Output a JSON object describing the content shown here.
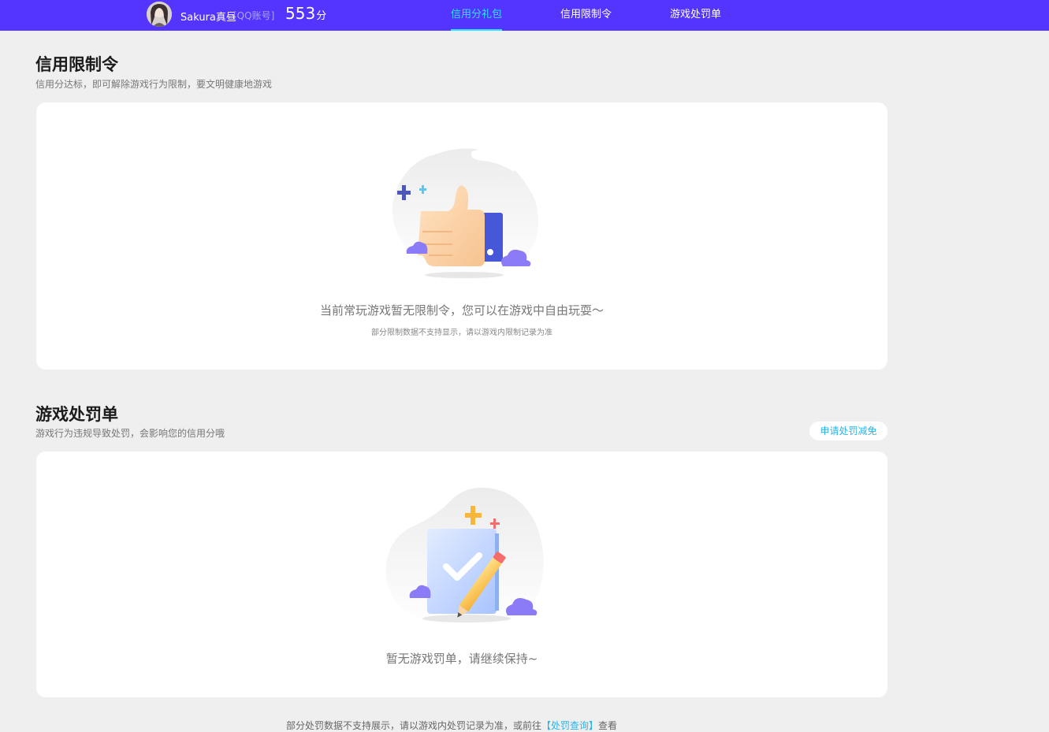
{
  "header": {
    "username": "Sakura真昼",
    "account_type": "[QQ账号]",
    "score": "553",
    "score_unit": "分",
    "tabs": [
      {
        "label": "信用分礼包",
        "active": true
      },
      {
        "label": "信用限制令",
        "active": false
      },
      {
        "label": "游戏处罚单",
        "active": false
      }
    ]
  },
  "restriction": {
    "title": "信用限制令",
    "subtitle": "信用分达标，即可解除游戏行为限制，要文明健康地游戏",
    "empty_text": "当前常玩游戏暂无限制令，您可以在游戏中自由玩耍～",
    "note": "部分限制数据不支持显示，请以游戏内限制记录为准"
  },
  "penalty": {
    "title": "游戏处罚单",
    "subtitle": "游戏行为违规导致处罚，会影响您的信用分哦",
    "appeal_button": "申请处罚减免",
    "empty_text": "暂无游戏罚单，请继续保持~"
  },
  "footer": {
    "note_before": "部分处罚数据不支持展示，请以游戏内处罚记录为准，或前往",
    "link": "【处罚查询】",
    "note_after": "查看"
  },
  "colors": {
    "topbar": "#5335ff",
    "active_tab": "#28e6ff",
    "link": "#27b4e8",
    "background": "#efefef"
  },
  "icons": [
    "avatar",
    "thumbs-up-icon",
    "checklist-pencil-icon"
  ]
}
